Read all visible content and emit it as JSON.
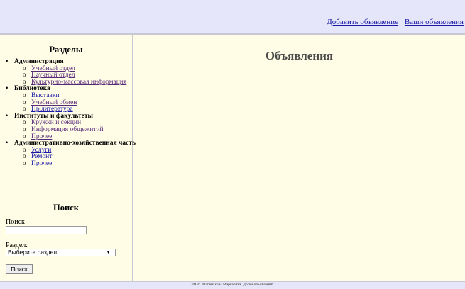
{
  "header": {
    "links": [
      "Добавить объявление",
      "Ваши объявления"
    ]
  },
  "sidebar": {
    "sections_title": "Разделы",
    "categories": [
      {
        "name": "Администрация",
        "items": [
          "Учебный отдел",
          "Научный отдел",
          "Культурно-массовая информация"
        ]
      },
      {
        "name": "Библиотека",
        "items": [
          "Выставки",
          "Учебный обмен",
          "Пр.литература"
        ]
      },
      {
        "name": "Институты и факультеты",
        "items": [
          "Кружки и секции",
          "Информация общежитий",
          "Прочее"
        ]
      },
      {
        "name": "Административно-хозяйственная часть",
        "items": [
          "Услуги",
          "Ремонт",
          "Прочее"
        ]
      }
    ],
    "search_title": "Поиск",
    "search_label": "Поиск",
    "search_value": "",
    "section_label": "Раздел:",
    "section_select_value": "Выберите раздел",
    "search_button": "Поиск"
  },
  "main": {
    "title": "Объявления"
  },
  "footer": {
    "text": "2018г. Шагвиахова Маргарита. Доска объявлений."
  },
  "icons": {
    "select_arrow": "chevron-down-icon"
  },
  "colors": {
    "header_bg": "#e6e6fa",
    "page_bg": "#fffde6",
    "link": "#1a1aa6",
    "link_visited": "#5a2a7a"
  }
}
